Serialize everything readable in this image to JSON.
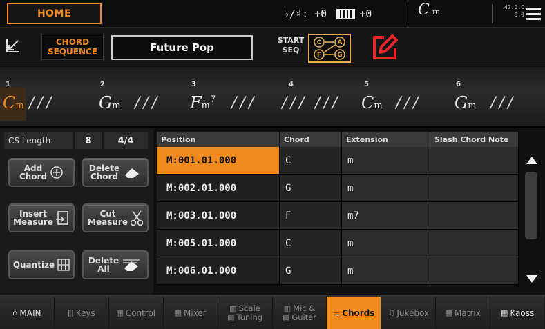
{
  "topbar": {
    "home_label": "HOME",
    "transpose_label": "♭/♯: +0",
    "keyboard_transpose": "+0",
    "chord_root": "C",
    "chord_suffix": "m",
    "tempo_line1": "42.0 C",
    "tempo_line2": "0.0"
  },
  "row2": {
    "title_line1": "CHORD",
    "title_line2": "SEQUENCE",
    "preset_name": "Future Pop",
    "start_line1": "START",
    "start_line2": "SEQ",
    "start_c": "C",
    "start_a": "A",
    "start_f": "F",
    "start_g": "G"
  },
  "strip": [
    {
      "num": "1",
      "root": "C",
      "suffix": "m",
      "sup": "",
      "active": true
    },
    {
      "num": "2",
      "root": "G",
      "suffix": "m",
      "sup": ""
    },
    {
      "num": "3",
      "root": "F",
      "suffix": "m",
      "sup": "7"
    },
    {
      "num": "4",
      "root": "",
      "suffix": "",
      "sup": ""
    },
    {
      "num": "5",
      "root": "C",
      "suffix": "m",
      "sup": ""
    },
    {
      "num": "6",
      "root": "G",
      "suffix": "m",
      "sup": ""
    }
  ],
  "strip_slashes": "///",
  "left": {
    "cs_length_label": "CS Length:",
    "cs_length_value": "8",
    "time_signature": "4/4",
    "buttons": {
      "add_chord": [
        "Add",
        "Chord"
      ],
      "delete_chord": [
        "Delete",
        "Chord"
      ],
      "insert_measure": [
        "Insert",
        "Measure"
      ],
      "cut_measure": [
        "Cut",
        "Measure"
      ],
      "quantize": [
        "Quantize"
      ],
      "delete_all": [
        "Delete",
        "All"
      ]
    }
  },
  "table": {
    "headers": [
      "Position",
      "Chord",
      "Extension",
      "Slash Chord Note"
    ],
    "rows": [
      {
        "position": "M:001.01.000",
        "chord": "C",
        "extension": "m",
        "slash": ""
      },
      {
        "position": "M:002.01.000",
        "chord": "G",
        "extension": "m",
        "slash": ""
      },
      {
        "position": "M:003.01.000",
        "chord": "F",
        "extension": "m7",
        "slash": ""
      },
      {
        "position": "M:005.01.000",
        "chord": "C",
        "extension": "m",
        "slash": ""
      },
      {
        "position": "M:006.01.000",
        "chord": "G",
        "extension": "m",
        "slash": ""
      }
    ]
  },
  "tabs": [
    {
      "label": "MAIN",
      "icon": "home-icon",
      "glyph": "⌂"
    },
    {
      "label": "Keys",
      "icon": "keys-icon",
      "glyph": "ǁǀ"
    },
    {
      "label": "Control",
      "icon": "control-icon",
      "glyph": "▦"
    },
    {
      "label": "Mixer",
      "icon": "mixer-icon",
      "glyph": "▦"
    },
    {
      "label": "Scale",
      "label2": "Tuning",
      "icon": "scale-icon",
      "glyph": "▥",
      "glyph2": "▤"
    },
    {
      "label": "Mic &",
      "label2": "Guitar",
      "icon": "mic-icon",
      "glyph": "▥",
      "glyph2": "▤"
    },
    {
      "label": "Chords",
      "icon": "chords-icon",
      "glyph": "☰"
    },
    {
      "label": "Jukebox",
      "icon": "jukebox-icon",
      "glyph": "♫"
    },
    {
      "label": "Matrix",
      "icon": "matrix-icon",
      "glyph": "▦"
    },
    {
      "label": "Kaoss",
      "icon": "kaoss-icon",
      "glyph": "▦"
    }
  ],
  "colors": {
    "accent": "#f08a1f",
    "start_seq_border": "#e7b04a",
    "edit_icon": "#e8262c"
  }
}
